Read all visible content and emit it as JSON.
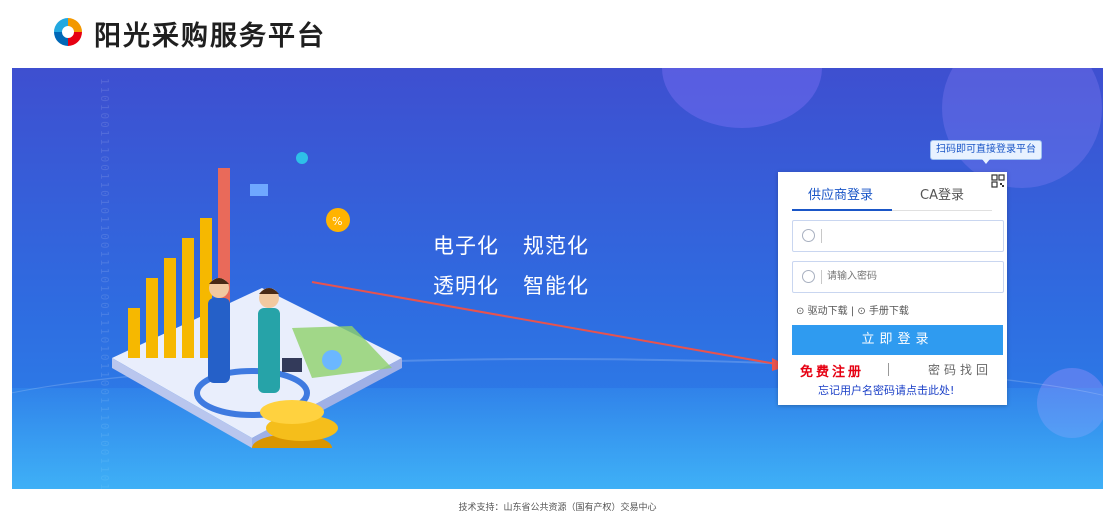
{
  "header": {
    "title": "阳光采购服务平台",
    "logo_icon": "sun-logo-icon"
  },
  "banner": {
    "slogans": [
      "电子化",
      "规范化",
      "透明化",
      "智能化"
    ]
  },
  "login": {
    "qr_tip": "扫码即可直接登录平台",
    "tabs": [
      {
        "label": "供应商登录",
        "active": true
      },
      {
        "label": "CA登录",
        "active": false
      }
    ],
    "username": {
      "value": "",
      "placeholder": ""
    },
    "password": {
      "value": "",
      "placeholder": "请输入密码"
    },
    "driver_download": "驱动下载",
    "manual_download": "手册下载",
    "separator": "|",
    "login_button": "立即登录",
    "register_link": "免费注册",
    "recover_link": "密码找回",
    "forgot_link": "忘记用户名密码请点击此处!"
  },
  "footer": {
    "text": "技术支持：山东省公共资源（国有产权）交易中心"
  },
  "colors": {
    "accent": "#2f9bf0",
    "tab_active": "#1a56c7",
    "register": "#e60012",
    "banner_top": "#3e4fd0",
    "banner_bottom": "#2a86ec"
  }
}
